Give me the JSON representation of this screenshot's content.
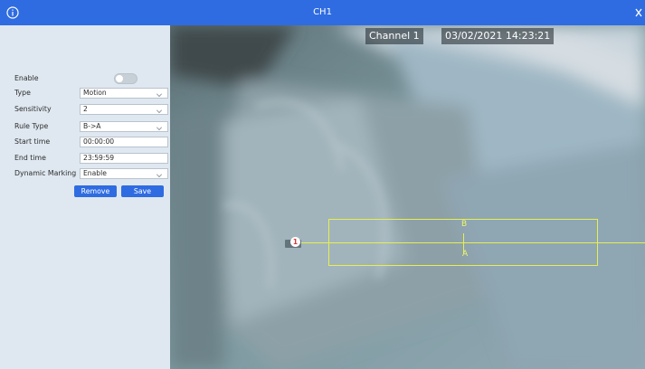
{
  "window": {
    "title": "CH1"
  },
  "settings": {
    "enable_label": "Enable",
    "enable_on": false,
    "type": {
      "label": "Type",
      "value": "Motion"
    },
    "sensitivity": {
      "label": "Sensitivity",
      "value": "2"
    },
    "rule_type": {
      "label": "Rule Type",
      "value": "B->A"
    },
    "start_time": {
      "label": "Start time",
      "value": "00:00:00"
    },
    "end_time": {
      "label": "End time",
      "value": "23:59:59"
    },
    "dynamic_marking": {
      "label": "Dynamic Marking",
      "value": "Enable"
    },
    "remove_label": "Remove",
    "save_label": "Save"
  },
  "video": {
    "channel_osd": "Channel 1",
    "datetime_osd": "03/02/2021 14:23:21",
    "rule_number": "1",
    "side_b": "B",
    "side_a": "A"
  },
  "colors": {
    "title_bar": "#2f6ce1",
    "button": "#2f6ce1",
    "rule_line": "#e6ef50",
    "panel": "#dfe8f0"
  },
  "icons": {
    "info": "info-icon",
    "close": "close-icon"
  }
}
